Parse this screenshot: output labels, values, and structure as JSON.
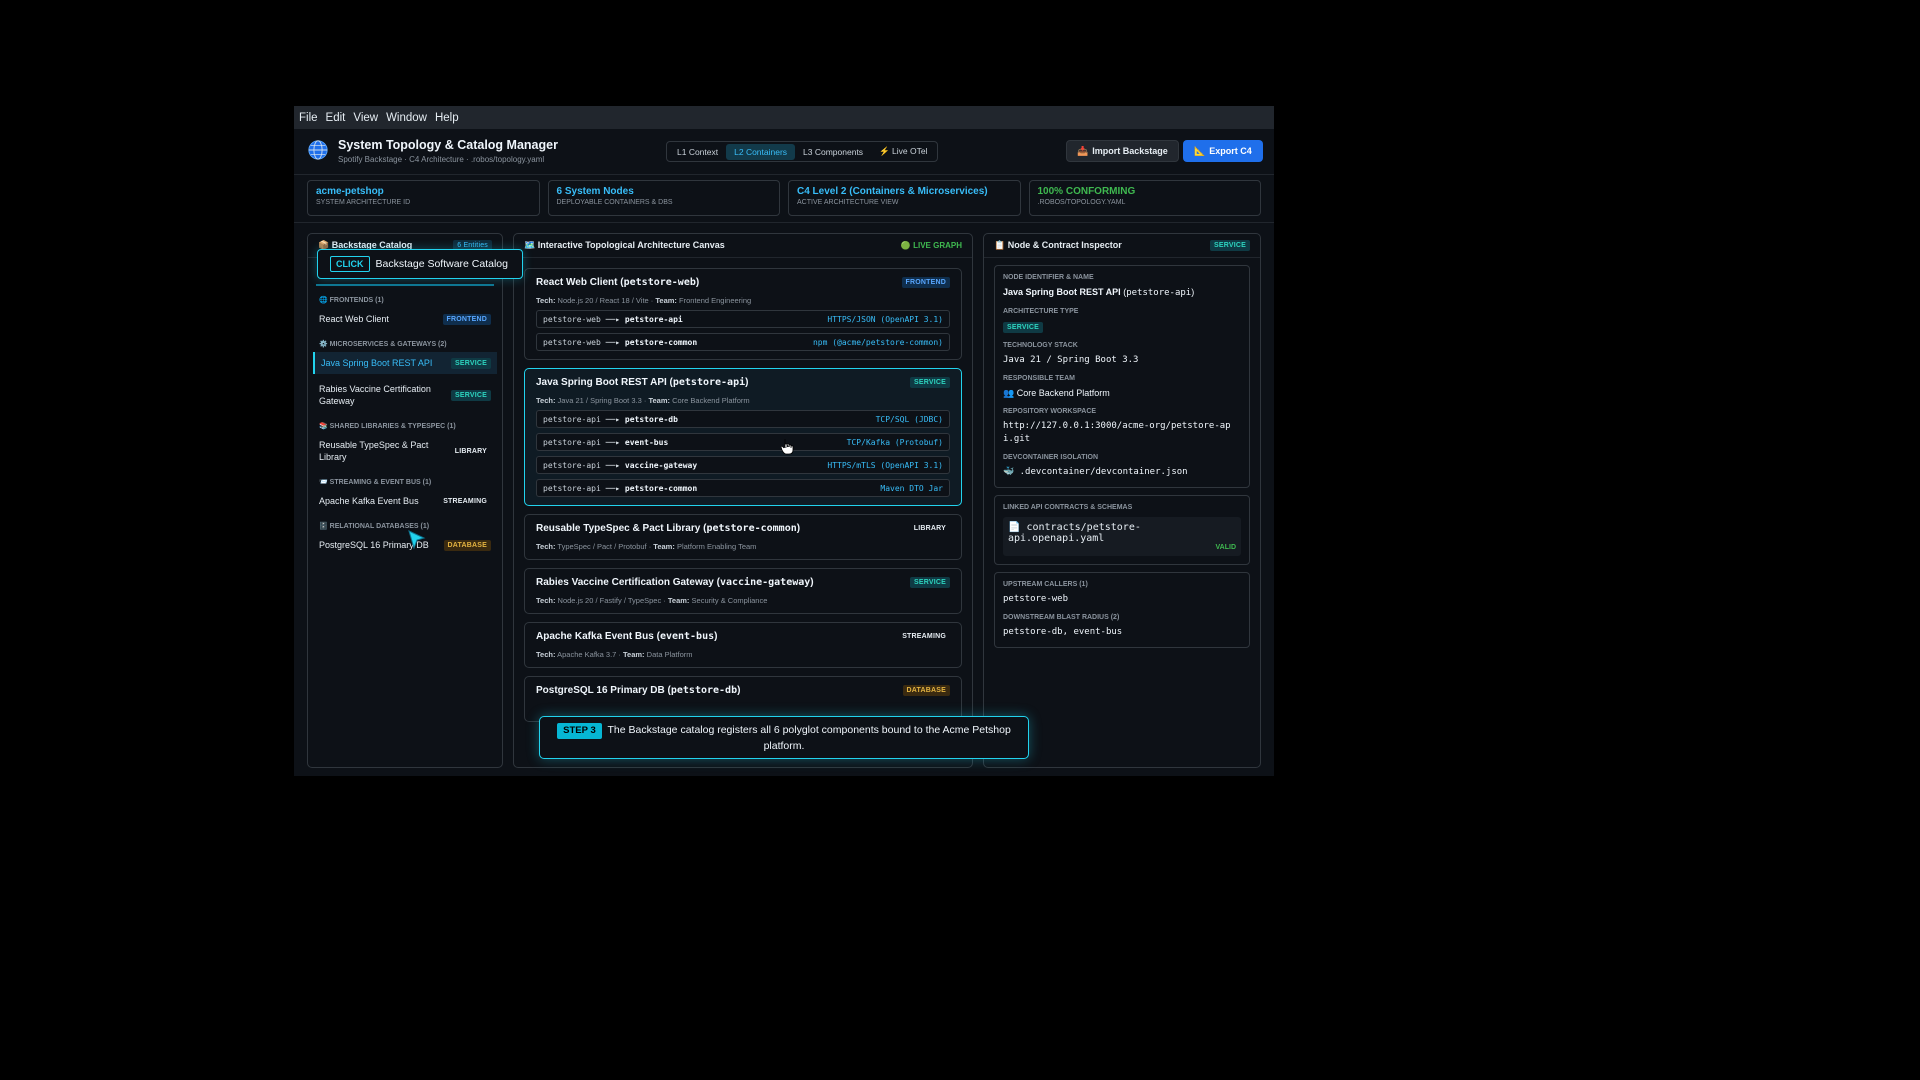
{
  "menu": [
    "File",
    "Edit",
    "View",
    "Window",
    "Help"
  ],
  "header": {
    "title": "System Topology & Catalog Manager",
    "subtitle": "Spotify Backstage · C4 Architecture · .robos/topology.yaml",
    "views": [
      "L1 Context",
      "L2 Containers",
      "L3 Components",
      "⚡ Live OTel"
    ],
    "active_view": "L2 Containers",
    "import_label": "Import Backstage",
    "export_label": "Export C4"
  },
  "stats": [
    {
      "value": "acme-petshop",
      "label": "System Architecture ID"
    },
    {
      "value": "6 System Nodes",
      "label": "Deployable Containers & DBs"
    },
    {
      "value": "C4 Level 2 (Containers & Microservices)",
      "label": "Active Architecture View"
    },
    {
      "value": "100% CONFORMING",
      "label": ".robos/topology.yaml"
    }
  ],
  "catalog": {
    "title": "📦 Backstage Catalog",
    "entities": "6 Entities",
    "groups": [
      {
        "label": "🌐 FRONTENDS (1)",
        "items": [
          {
            "name": "React Web Client",
            "badge": "FRONTEND"
          }
        ]
      },
      {
        "label": "⚙️ MICROSERVICES & GATEWAYS (2)",
        "items": [
          {
            "name": "Java Spring Boot REST API",
            "badge": "SERVICE"
          },
          {
            "name": "Rabies Vaccine Certification Gateway",
            "badge": "SERVICE"
          }
        ]
      },
      {
        "label": "📚 SHARED LIBRARIES & TYPESPEC (1)",
        "items": [
          {
            "name": "Reusable TypeSpec & Pact Library",
            "badge": "LIBRARY"
          }
        ]
      },
      {
        "label": "📨 STREAMING & EVENT BUS (1)",
        "items": [
          {
            "name": "Apache Kafka Event Bus",
            "badge": "STREAMING"
          }
        ]
      },
      {
        "label": "🗄️ RELATIONAL DATABASES (1)",
        "items": [
          {
            "name": "PostgreSQL 16 Primary DB",
            "badge": "DATABASE"
          }
        ]
      }
    ]
  },
  "canvas": {
    "title": "🗺️ Interactive Topological Architecture Canvas",
    "live": "🟢 LIVE GRAPH",
    "cards": [
      {
        "name": "React Web Client",
        "id": "petstore-web",
        "badge": "FRONTEND",
        "tech": "Node.js 20 / React 18 / Vite",
        "team": "Frontend Engineering",
        "edges": [
          {
            "src": "petstore-web",
            "tgt": "petstore-api",
            "proto": "HTTPS/JSON (OpenAPI 3.1)"
          },
          {
            "src": "petstore-web",
            "tgt": "petstore-common",
            "proto": "npm (@acme/petstore-common)"
          }
        ]
      },
      {
        "name": "Java Spring Boot REST API",
        "id": "petstore-api",
        "badge": "SERVICE",
        "tech": "Java 21 / Spring Boot 3.3",
        "team": "Core Backend Platform",
        "edges": [
          {
            "src": "petstore-api",
            "tgt": "petstore-db",
            "proto": "TCP/SQL (JDBC)"
          },
          {
            "src": "petstore-api",
            "tgt": "event-bus",
            "proto": "TCP/Kafka (Protobuf)"
          },
          {
            "src": "petstore-api",
            "tgt": "vaccine-gateway",
            "proto": "HTTPS/mTLS (OpenAPI 3.1)"
          },
          {
            "src": "petstore-api",
            "tgt": "petstore-common",
            "proto": "Maven DTO Jar"
          }
        ]
      },
      {
        "name": "Reusable TypeSpec & Pact Library",
        "id": "petstore-common",
        "badge": "LIBRARY",
        "tech": "TypeSpec / Pact / Protobuf",
        "team": "Platform Enabling Team",
        "edges": []
      },
      {
        "name": "Rabies Vaccine Certification Gateway",
        "id": "vaccine-gateway",
        "badge": "SERVICE",
        "tech": "Node.js 20 / Fastify / TypeSpec",
        "team": "Security & Compliance",
        "edges": []
      },
      {
        "name": "Apache Kafka Event Bus",
        "id": "event-bus",
        "badge": "STREAMING",
        "tech": "Apache Kafka 3.7",
        "team": "Data Platform",
        "edges": []
      },
      {
        "name": "PostgreSQL 16 Primary DB",
        "id": "petstore-db",
        "badge": "DATABASE",
        "tech": "",
        "team": "",
        "edges": []
      }
    ]
  },
  "inspector": {
    "title": "📋 Node & Contract Inspector",
    "badge": "SERVICE",
    "node_label": "Node Identifier & Name",
    "node_name": "Java Spring Boot REST API",
    "node_id": "petstore-api",
    "arch_label": "Architecture Type",
    "arch_value": "SERVICE",
    "tech_label": "Technology Stack",
    "tech_value": "Java 21 / Spring Boot 3.3",
    "team_label": "Responsible Team",
    "team_value": "👥 Core Backend Platform",
    "repo_label": "Repository Workspace",
    "repo_value": "http://127.0.0.1:3000/acme-org/petstore-api.git",
    "dev_label": "Devcontainer Isolation",
    "dev_value": "🐳 .devcontainer/devcontainer.json",
    "contracts_label": "Linked API Contracts & Schemas",
    "contract_file": "📄 contracts/petstore-api.openapi.yaml",
    "contract_status": "VALID",
    "upstream_label": "Upstream Callers (1)",
    "upstream_value": "petstore-web",
    "downstream_label": "Downstream Blast Radius (2)",
    "downstream_value": "petstore-db, event-bus"
  },
  "tooltip": {
    "tag": "CLICK",
    "text": "Backstage Software Catalog"
  },
  "step": {
    "tag": "STEP 3",
    "text": "The Backstage catalog registers all 6 polyglot components bound to the Acme Petshop platform."
  }
}
